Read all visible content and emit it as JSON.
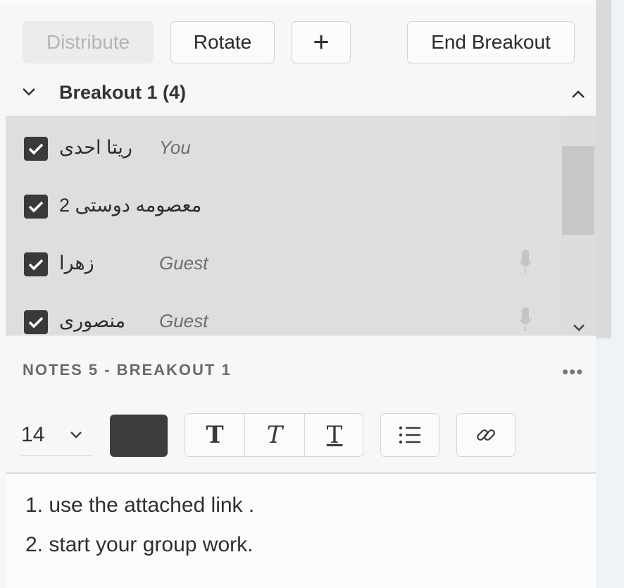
{
  "toolbar": {
    "distribute": "Distribute",
    "rotate": "Rotate",
    "add": "+",
    "end_breakout": "End Breakout"
  },
  "breakout": {
    "title": "Breakout 1 (4)"
  },
  "participants": [
    {
      "name": "ریتا احدی",
      "role": "You",
      "checked": true
    },
    {
      "name": "معصومه دوستی 2",
      "role": "",
      "checked": true
    },
    {
      "name": "زهرا",
      "role": "Guest",
      "checked": true
    },
    {
      "name": "منصوری",
      "role": "Guest",
      "checked": true
    }
  ],
  "notes": {
    "title": "NOTES 5  - BREAKOUT 1",
    "more": "•••",
    "font_size": "14",
    "text_color": "#3d3d3d",
    "format_buttons": [
      "T",
      "T",
      "T"
    ],
    "lines": [
      "1. use the attached link .",
      "2. start your group work."
    ]
  },
  "icons": {
    "collapse": "chevron-down-icon",
    "scroll_up": "chevron-up-icon",
    "scroll_down": "chevron-down-icon",
    "mic": "microphone-icon",
    "list": "bulleted-list-icon",
    "link": "link-icon",
    "checkbox": "checkbox-checked-icon"
  }
}
